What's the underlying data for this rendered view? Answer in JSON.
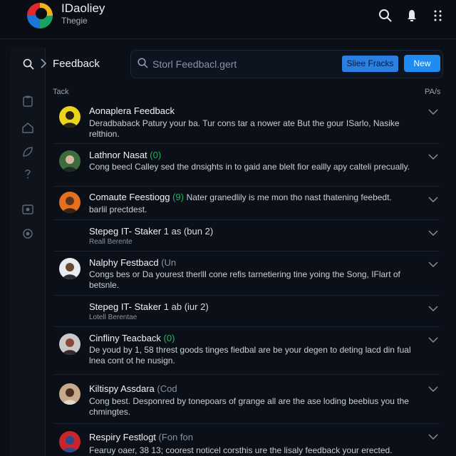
{
  "header": {
    "title": "IDaoliey",
    "subtitle": "Thegie",
    "logo_colors": [
      "#e4262e",
      "#f2b21c",
      "#1b74d8",
      "#1aa160"
    ]
  },
  "nav": {
    "section_title": "Feedback",
    "search_placeholder": "Storl Feedbacl.gert"
  },
  "buttons": {
    "secondary_label": "Sliee Fracks",
    "primary_label": "New"
  },
  "columns": {
    "left": "Tack",
    "right": "PA/s"
  },
  "colors": {
    "accent": "#1e8cf0",
    "tag_green": "#25b55f",
    "background": "#0b0f17"
  },
  "rows": [
    {
      "title": "Aonaplera Feedback",
      "tag": "",
      "desc": "Deradbaback Patury your ba. Tur cons tar a nower ate But the gour ISarlo, Nasike relthion.",
      "sub": "",
      "avatar": "yellow"
    },
    {
      "title": "Lathnor Nasat",
      "tag": "(0)",
      "desc": "Cong beecl Calley sed the dnsights in to gaid ane blelt fior eallly apy calteli precually.",
      "sub": "",
      "avatar": "green"
    },
    {
      "title": "Comaute Feestiogg",
      "tag": "(9)",
      "inline": "Nater granedlily is me mon tho nast thatening feebedt.",
      "desc": "barlil prectdest.",
      "sub": "",
      "avatar": "orange"
    },
    {
      "title": "Stepeg IT- Staker",
      "tag": "1 as (bun 2)",
      "desc": "",
      "sub": "Reall Berente",
      "avatar": ""
    },
    {
      "title": "Nalphy Festbacd",
      "tag": "(Un",
      "desc": "Congs bes or Da yourest therlll cone refis tarnetiering tine yoing the Song, IFlart of betsnle.",
      "sub": "",
      "avatar": "white"
    },
    {
      "title": "Stepeg IT- Staker",
      "tag": "1 ab (iur 2)",
      "desc": "",
      "sub": "Lotell Berentae",
      "avatar": ""
    },
    {
      "title": "Cinfliny Teacback",
      "tag": "(0)",
      "desc": "De youd by 1, 58 threst goods tinges fiedbal are be your degen to deting lacd din fual lnea cont ot he nusign.",
      "sub": "",
      "avatar": "grey"
    },
    {
      "title": "Kiltispy Assdara",
      "tag": "(Cod",
      "desc": "Cong best. Desponred by tonepoars of grange all are the ase loding beebius you the chmingtes.",
      "sub": "",
      "avatar": "tan"
    },
    {
      "title": "Respiry Festlogt",
      "tag": "(Fon fon",
      "desc": "Fearuy oaer, 38 13; coorest noticel corsthis ure the lisaly feedback your erected.",
      "sub": "",
      "avatar": "red"
    }
  ]
}
